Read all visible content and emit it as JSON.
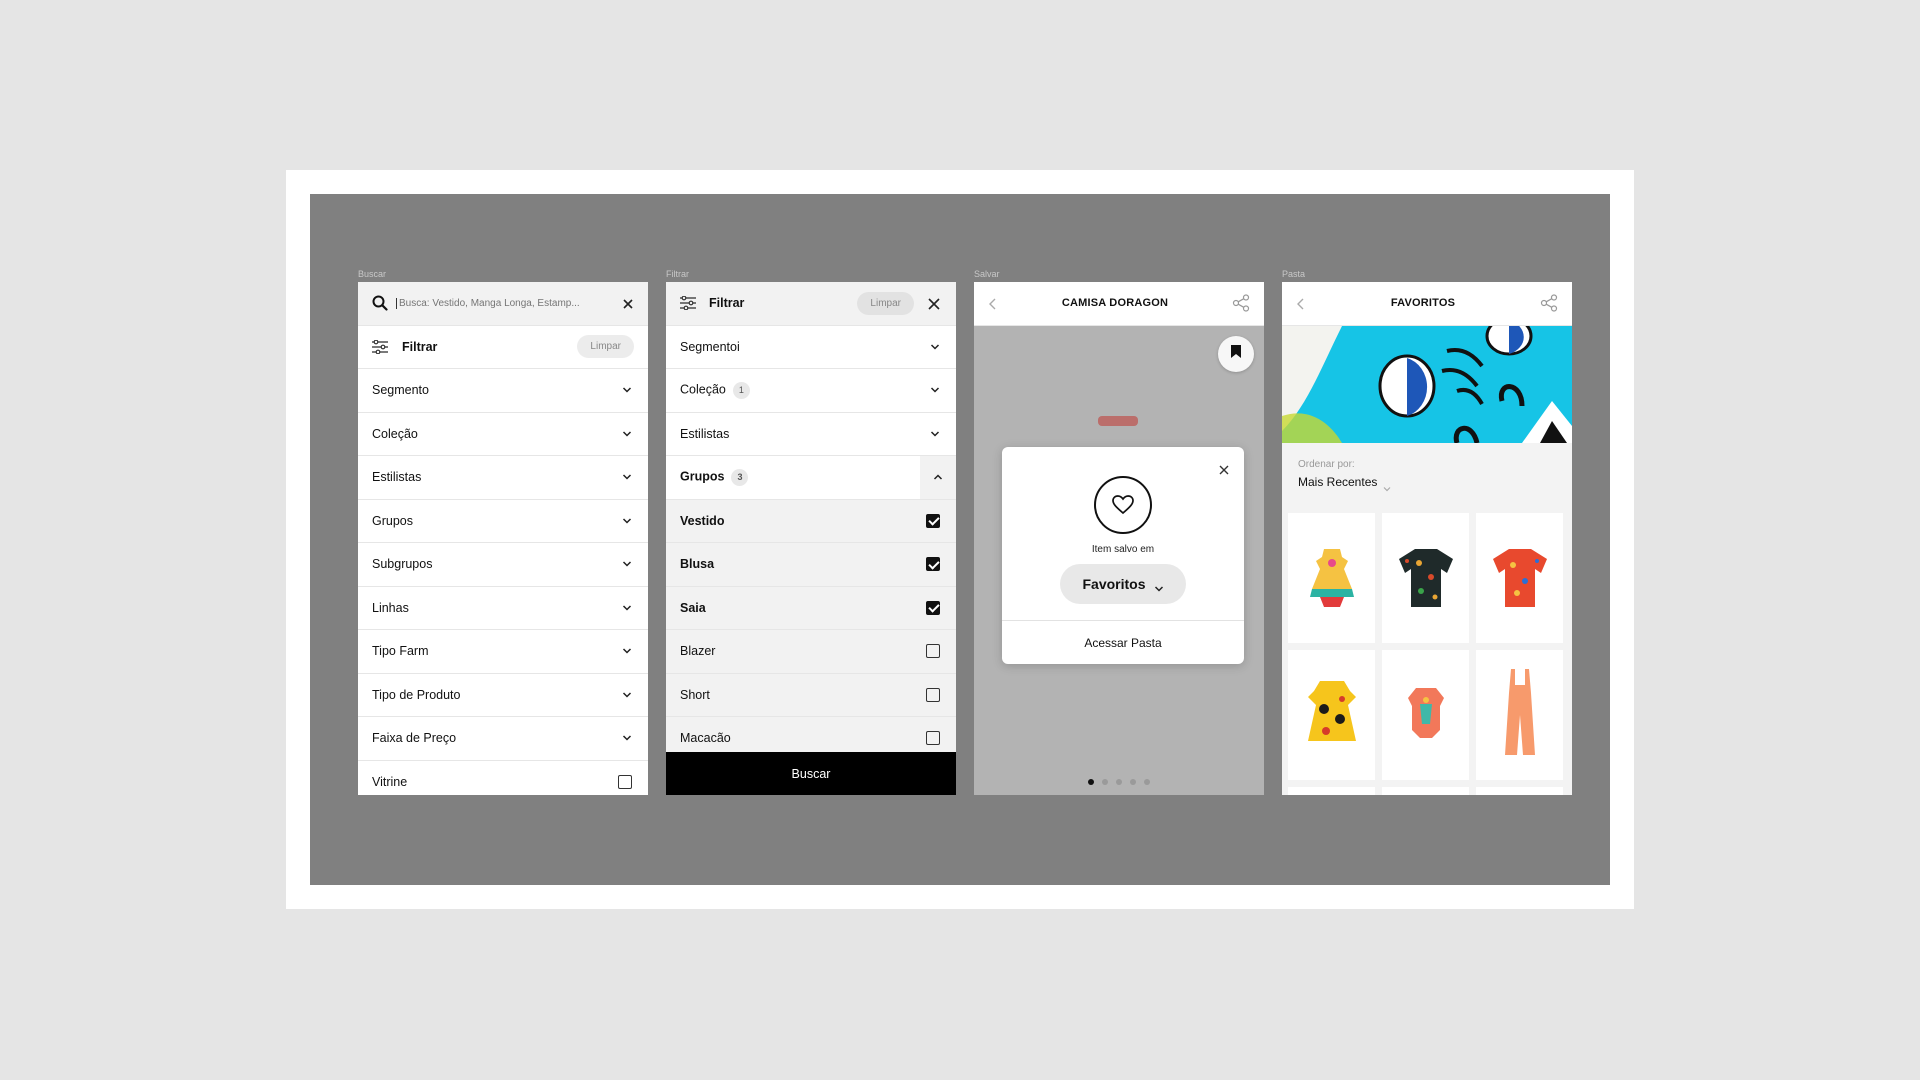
{
  "screens": [
    {
      "label": "Buscar",
      "search_placeholder": "Busca: Vestido, Manga Longa, Estamp...",
      "filter_title": "Filtrar",
      "clear_label": "Limpar",
      "items": [
        "Segmento",
        "Coleção",
        "Estilistas",
        "Grupos",
        "Subgrupos",
        "Linhas",
        "Tipo Farm",
        "Tipo de Produto",
        "Faixa de Preço"
      ],
      "last_item": "Vitrine"
    },
    {
      "label": "Filtrar",
      "filter_title": "Filtrar",
      "clear_label": "Limpar",
      "items": [
        {
          "label": "Segmentoi"
        },
        {
          "label": "Coleção",
          "badge": "1"
        },
        {
          "label": "Estilistas"
        },
        {
          "label": "Grupos",
          "badge": "3"
        }
      ],
      "options": [
        {
          "label": "Vestido",
          "checked": true
        },
        {
          "label": "Blusa",
          "checked": true
        },
        {
          "label": "Saia",
          "checked": true
        },
        {
          "label": "Blazer",
          "checked": false
        },
        {
          "label": "Short",
          "checked": false
        },
        {
          "label": "Macacão",
          "checked": false
        }
      ],
      "search_button": "Buscar"
    },
    {
      "label": "Salvar",
      "title": "CAMISA DORAGON",
      "saved_in_label": "Item salvo em",
      "folder_name": "Favoritos",
      "access_folder": "Acessar Pasta",
      "carousel_pages": 5,
      "carousel_active": 1
    },
    {
      "label": "Pasta",
      "title": "FAVORITOS",
      "sort_label": "Ordenar por:",
      "sort_value": "Mais Recentes"
    }
  ],
  "colors": {
    "page_bg": "#e5e5e5",
    "frame_gray": "#808080",
    "accent_black": "#000000",
    "banner_cyan": "#16c4e6"
  }
}
